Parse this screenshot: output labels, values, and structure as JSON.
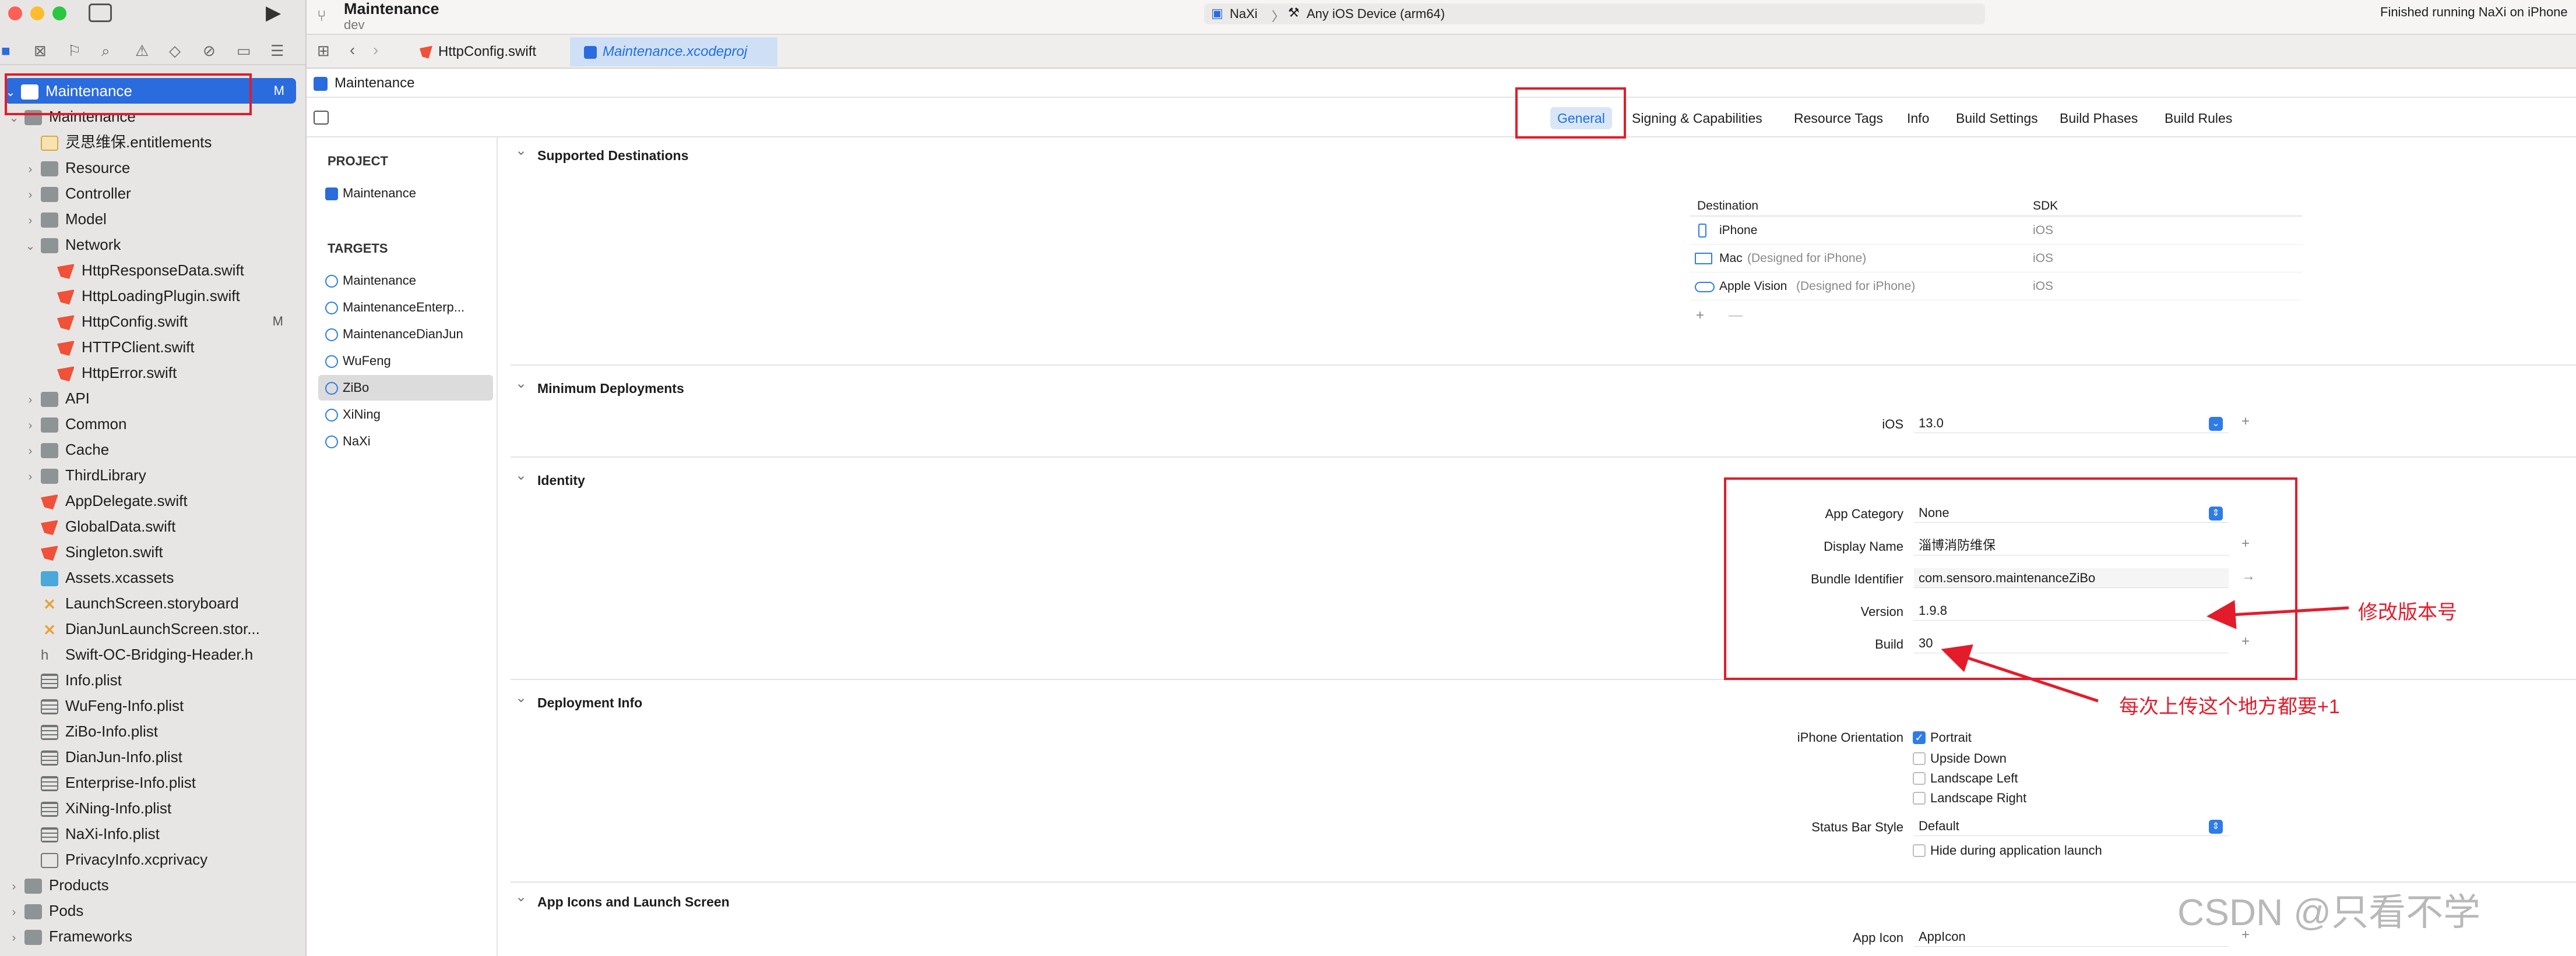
{
  "window": {
    "project_title": "Maintenance",
    "branch": "dev",
    "scheme": "NaXi",
    "run_destination": "Any iOS Device (arm64)",
    "status": "Finished running NaXi on iPhone"
  },
  "navigator": {
    "root": {
      "label": "Maintenance",
      "badge": "M"
    },
    "items": [
      {
        "label": "Maintenance",
        "kind": "folder",
        "indent": 1,
        "chev": "open"
      },
      {
        "label": "灵思维保.entitlements",
        "kind": "ent",
        "indent": 2
      },
      {
        "label": "Resource",
        "kind": "folder",
        "indent": 2,
        "chev": "closed"
      },
      {
        "label": "Controller",
        "kind": "folder",
        "indent": 2,
        "chev": "closed"
      },
      {
        "label": "Model",
        "kind": "folder",
        "indent": 2,
        "chev": "closed"
      },
      {
        "label": "Network",
        "kind": "folder",
        "indent": 2,
        "chev": "open"
      },
      {
        "label": "HttpResponseData.swift",
        "kind": "swift",
        "indent": 3
      },
      {
        "label": "HttpLoadingPlugin.swift",
        "kind": "swift",
        "indent": 3
      },
      {
        "label": "HttpConfig.swift",
        "kind": "swift",
        "indent": 3,
        "badge": "M"
      },
      {
        "label": "HTTPClient.swift",
        "kind": "swift",
        "indent": 3
      },
      {
        "label": "HttpError.swift",
        "kind": "swift",
        "indent": 3
      },
      {
        "label": "API",
        "kind": "folder",
        "indent": 2,
        "chev": "closed"
      },
      {
        "label": "Common",
        "kind": "folder",
        "indent": 2,
        "chev": "closed"
      },
      {
        "label": "Cache",
        "kind": "folder",
        "indent": 2,
        "chev": "closed"
      },
      {
        "label": "ThirdLibrary",
        "kind": "folder",
        "indent": 2,
        "chev": "closed"
      },
      {
        "label": "AppDelegate.swift",
        "kind": "swift",
        "indent": 2
      },
      {
        "label": "GlobalData.swift",
        "kind": "swift",
        "indent": 2
      },
      {
        "label": "Singleton.swift",
        "kind": "swift",
        "indent": 2
      },
      {
        "label": "Assets.xcassets",
        "kind": "assets",
        "indent": 2
      },
      {
        "label": "LaunchScreen.storyboard",
        "kind": "story",
        "indent": 2
      },
      {
        "label": "DianJunLaunchScreen.stor...",
        "kind": "story",
        "indent": 2
      },
      {
        "label": "Swift-OC-Bridging-Header.h",
        "kind": "h",
        "indent": 2
      },
      {
        "label": "Info.plist",
        "kind": "plist",
        "indent": 2
      },
      {
        "label": "WuFeng-Info.plist",
        "kind": "plist",
        "indent": 2
      },
      {
        "label": "ZiBo-Info.plist",
        "kind": "plist",
        "indent": 2
      },
      {
        "label": "DianJun-Info.plist",
        "kind": "plist",
        "indent": 2
      },
      {
        "label": "Enterprise-Info.plist",
        "kind": "plist",
        "indent": 2
      },
      {
        "label": "XiNing-Info.plist",
        "kind": "plist",
        "indent": 2
      },
      {
        "label": "NaXi-Info.plist",
        "kind": "plist",
        "indent": 2
      },
      {
        "label": "PrivacyInfo.xcprivacy",
        "kind": "privacy",
        "indent": 2
      },
      {
        "label": "Products",
        "kind": "folder",
        "indent": 1,
        "chev": "closed"
      },
      {
        "label": "Pods",
        "kind": "folder",
        "indent": 1,
        "chev": "closed"
      },
      {
        "label": "Frameworks",
        "kind": "folder",
        "indent": 1,
        "chev": "closed"
      }
    ]
  },
  "tabs": [
    "HttpConfig.swift",
    "Maintenance.xcodeproj"
  ],
  "breadcrumb": "Maintenance",
  "editor_tabs": [
    "General",
    "Signing & Capabilities",
    "Resource Tags",
    "Info",
    "Build Settings",
    "Build Phases",
    "Build Rules"
  ],
  "targets_panel": {
    "project_header": "PROJECT",
    "project": "Maintenance",
    "targets_header": "TARGETS",
    "targets": [
      "Maintenance",
      "MaintenanceEnterp...",
      "MaintenanceDianJun",
      "WuFeng",
      "ZiBo",
      "XiNing",
      "NaXi"
    ],
    "selected": "ZiBo"
  },
  "sections": {
    "destinations": {
      "title": "Supported Destinations",
      "col_destination": "Destination",
      "col_sdk": "SDK",
      "rows": [
        {
          "name": "iPhone",
          "note": "",
          "sdk": "iOS"
        },
        {
          "name": "Mac",
          "note": "(Designed for iPhone)",
          "sdk": "iOS"
        },
        {
          "name": "Apple Vision",
          "note": "(Designed for iPhone)",
          "sdk": "iOS"
        }
      ],
      "add": "+",
      "remove": "—"
    },
    "min_deploy": {
      "title": "Minimum Deployments",
      "label": "iOS",
      "value": "13.0"
    },
    "identity": {
      "title": "Identity",
      "app_category_label": "App Category",
      "app_category": "None",
      "display_name_label": "Display Name",
      "display_name": "淄博消防维保",
      "bundle_id_label": "Bundle Identifier",
      "bundle_id": "com.sensoro.maintenanceZiBo",
      "version_label": "Version",
      "version": "1.9.8",
      "build_label": "Build",
      "build": "30"
    },
    "deployment": {
      "title": "Deployment Info",
      "orientation_label": "iPhone Orientation",
      "orientations": [
        {
          "label": "Portrait",
          "checked": true
        },
        {
          "label": "Upside Down",
          "checked": false
        },
        {
          "label": "Landscape Left",
          "checked": false
        },
        {
          "label": "Landscape Right",
          "checked": false
        }
      ],
      "status_bar_label": "Status Bar Style",
      "status_bar": "Default",
      "hide_launch": "Hide during application launch"
    },
    "icons": {
      "title": "App Icons and Launch Screen",
      "app_icon_label": "App Icon",
      "app_icon": "AppIcon"
    }
  },
  "annotations": {
    "version_note": "修改版本号",
    "build_note": "每次上传这个地方都要+1"
  },
  "watermark": "CSDN @只看不学",
  "colors": {
    "accent": "#2a6bde",
    "annotation": "#e31c2b"
  }
}
